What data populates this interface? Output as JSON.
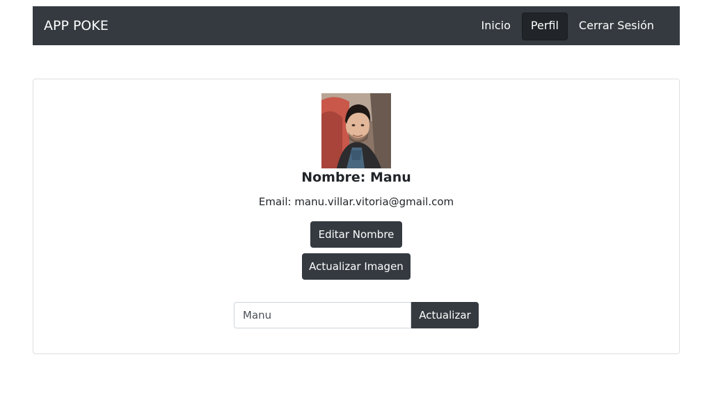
{
  "navbar": {
    "brand": "APP POKE",
    "items": [
      {
        "label": "Inicio",
        "active": false
      },
      {
        "label": "Perfil",
        "active": true
      },
      {
        "label": "Cerrar Sesión",
        "active": false
      }
    ]
  },
  "profile": {
    "name": "Nombre: Manu",
    "email": "Email: manu.villar.vitoria@gmail.com",
    "edit_name_label": "Editar Nombre",
    "update_image_label": "Actualizar Imagen",
    "name_input_value": "Manu",
    "update_button_label": "Actualizar"
  },
  "colors": {
    "navbar_bg": "#343a40",
    "button_dark": "#343a40",
    "active_nav_bg": "#212529"
  }
}
